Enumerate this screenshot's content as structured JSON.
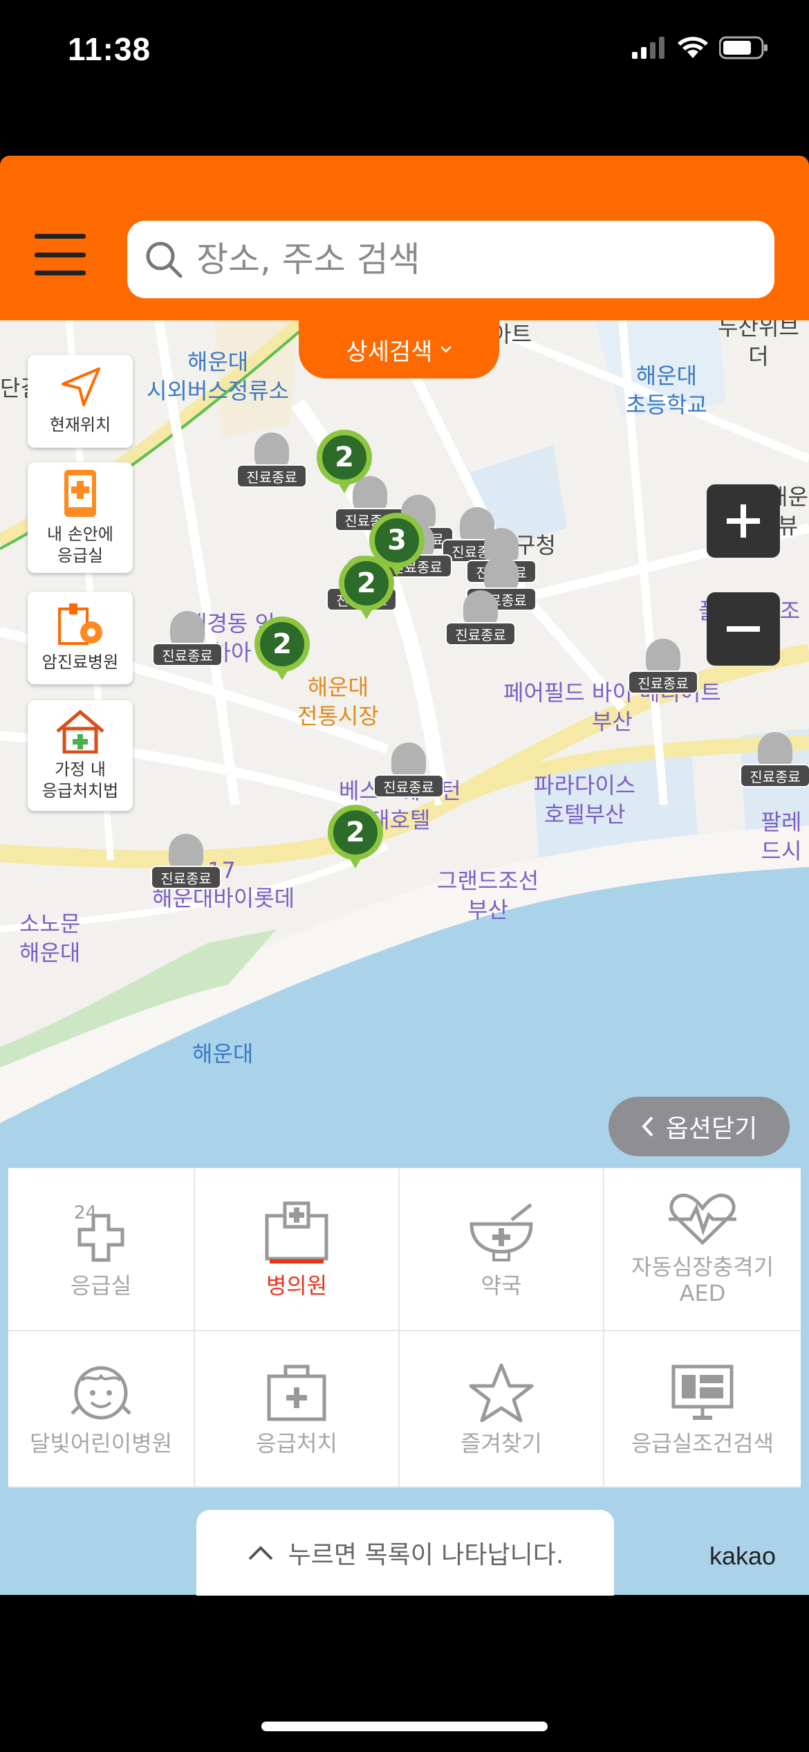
{
  "status": {
    "time": "11:38"
  },
  "search": {
    "placeholder": "장소, 주소 검색"
  },
  "detail_search": {
    "label": "상세검색"
  },
  "side_buttons": [
    {
      "label": "현재위치",
      "icon": "location-arrow-icon"
    },
    {
      "label": "내 손안에\n응급실",
      "icon": "phone-hospital-icon"
    },
    {
      "label": "암진료병원",
      "icon": "cancer-hospital-icon"
    },
    {
      "label": "가정 내\n응급처치법",
      "icon": "home-firstaid-icon"
    }
  ],
  "zoom": {
    "in": "+",
    "out": "−"
  },
  "map_labels": {
    "bus_terminal": "해운대\n시외버스정류소",
    "elementary": "해운대\n초등학교",
    "top_right": "두산위브더",
    "ward_office": "구청",
    "hospital_partial": "대경동 인\n차아",
    "market": "해운대\n전통시장",
    "fairfield": "페어필드 바이 메리어트\n부산",
    "paradise": "파라다이스\n호텔부산",
    "best_western": "베스트웨스턴\n대호텔",
    "grand_chosun": "그랜드조선\n부산",
    "lotte": "해운대바이롯데",
    "sonomun": "소노문\n해운대",
    "beach": "해운대",
    "palais": "팔레드시",
    "fullaeri": "풀에이리조\n해운대",
    "left_edge": "단길",
    "apt": "아트",
    "right_edge_top": "해운\n뷰",
    "num_17": "17"
  },
  "closed_tag": "진료종료",
  "clusters": [
    "2",
    "2",
    "2",
    "2",
    "3"
  ],
  "close_options": {
    "label": "옵션닫기"
  },
  "categories": [
    {
      "label": "응급실",
      "icon": "emergency-24-icon",
      "badge": "24"
    },
    {
      "label": "병의원",
      "icon": "hospital-icon",
      "active": true
    },
    {
      "label": "약국",
      "icon": "pharmacy-icon"
    },
    {
      "label": "자동심장충격기\nAED",
      "icon": "aed-icon"
    },
    {
      "label": "달빛어린이병원",
      "icon": "child-face-icon"
    },
    {
      "label": "응급처치",
      "icon": "first-aid-kit-icon"
    },
    {
      "label": "즐겨찾기",
      "icon": "star-icon"
    },
    {
      "label": "응급실조건검색",
      "icon": "monitor-icon"
    }
  ],
  "list_toggle": {
    "label": "누르면 목록이 나타납니다."
  },
  "brand": "kakao",
  "colors": {
    "header": "#ff6a00",
    "cluster": "#2d6b2a",
    "active": "#e8341c",
    "sea": "#aad3e9"
  }
}
